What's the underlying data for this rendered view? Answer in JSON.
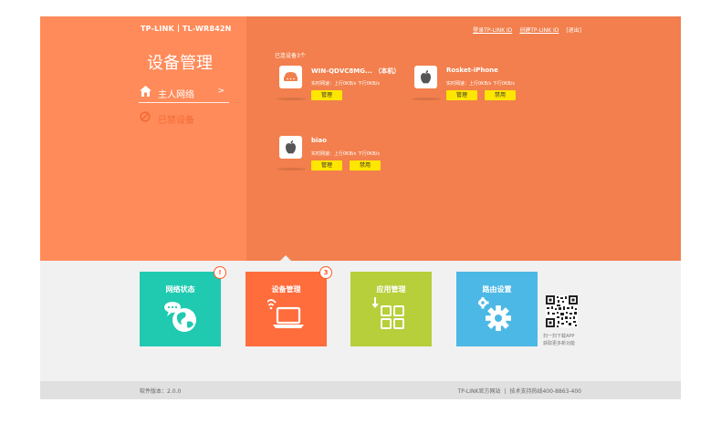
{
  "brand": {
    "logo": "TP-LINK",
    "model": "TL-WR842N"
  },
  "header": {
    "login_link": "登录TP-LINK ID",
    "create_link": "创建TP-LINK ID",
    "exit": "[退出]"
  },
  "sidebar": {
    "title": "设备管理",
    "items": [
      {
        "label": "主人网络",
        "arrow": ">"
      },
      {
        "label": "已禁设备"
      }
    ]
  },
  "main": {
    "connected_label": "已连设备3个",
    "devices": [
      {
        "name": "WIN-QDVC8MG... （本机）",
        "speed": "实时网速：上行0KB/s  下行0KB/s",
        "icon": "router-icon",
        "buttons": [
          "管理"
        ]
      },
      {
        "name": "Rosket-iPhone",
        "speed": "实时网速：上行0KB/s  下行0KB/s",
        "icon": "apple-icon",
        "buttons": [
          "管理",
          "禁用"
        ]
      },
      {
        "name": "biao",
        "speed": "实时网速：上行0KB/s  下行0KB/s",
        "icon": "apple-icon",
        "buttons": [
          "管理",
          "禁用"
        ]
      }
    ]
  },
  "tiles": [
    {
      "label": "网络状态",
      "color": "#1fcab0",
      "badge": "!"
    },
    {
      "label": "设备管理",
      "color": "#ff6d3d",
      "badge": "3"
    },
    {
      "label": "应用管理",
      "color": "#b6cf3a"
    },
    {
      "label": "路由设置",
      "color": "#4cb8e5"
    }
  ],
  "qr": {
    "line1": "扫一扫下载APP",
    "line2": "获取更多新功能"
  },
  "footer": {
    "version": "软件版本：2.0.0",
    "site": "TP-LINK官方网站",
    "sep": "|",
    "support": "技术支持热线400-8863-400"
  }
}
